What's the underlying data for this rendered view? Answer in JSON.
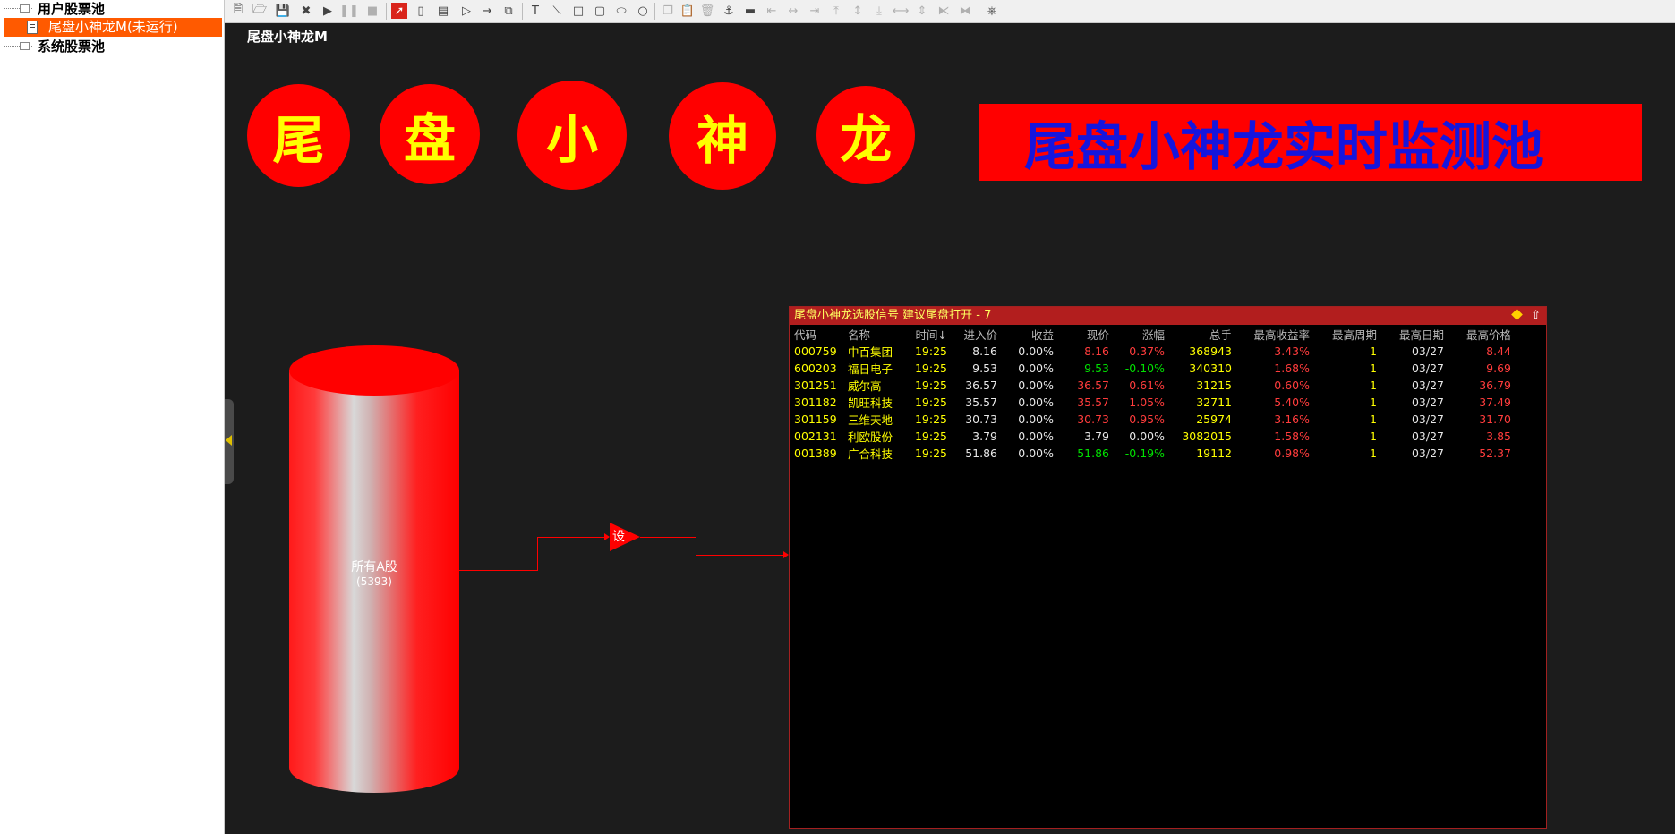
{
  "tree": {
    "user_pool": "用户股票池",
    "selected_item": "尾盘小神龙M(未运行)",
    "system_pool": "系统股票池"
  },
  "toolbar": {
    "icons": [
      "new-file-icon",
      "open-folder-icon",
      "save-icon",
      "close-icon",
      "run-icon",
      "pause-icon",
      "stop-icon",
      "pointer-icon",
      "rounded-rect-tool-icon",
      "table-tool-icon",
      "play-tool-icon",
      "arrow-tool-icon",
      "group-tool-icon",
      "text-tool-icon",
      "line-tool-icon",
      "rect-tool-icon",
      "round-rect-tool-icon",
      "ellipse-tool-icon",
      "circle-tool-icon",
      "copy-icon",
      "paste-icon",
      "delete-icon",
      "fill-icon",
      "line-style-icon",
      "align-left-icon",
      "align-center-icon",
      "align-right-icon",
      "align-top-icon",
      "align-middle-icon",
      "align-bottom-icon",
      "same-width-icon",
      "same-height-icon",
      "distribute-h-icon",
      "distribute-v-icon",
      "layout-icon"
    ]
  },
  "canvas": {
    "title": "尾盘小神龙M",
    "circles": [
      "尾",
      "盘",
      "小",
      "神",
      "龙"
    ],
    "banner": "尾盘小神龙实时监测池",
    "cylinder_label": "所有A股",
    "cylinder_count": "(5393)",
    "filter_label": "设"
  },
  "panel": {
    "title": "尾盘小神龙选股信号 建议尾盘打开 - 7",
    "columns": [
      "代码",
      "名称",
      "时间↓",
      "进入价",
      "收益",
      "现价",
      "涨幅",
      "总手",
      "最高收益率",
      "最高周期",
      "最高日期",
      "最高价格"
    ],
    "rows": [
      {
        "code": "000759",
        "name": "中百集团",
        "time": "19:25",
        "entry": "8.16",
        "gain": "0.00%",
        "price": "8.16",
        "change": "0.37%",
        "volume": "368943",
        "max_rate": "3.43%",
        "max_period": "1",
        "max_date": "03/27",
        "max_price": "8.44",
        "trend": "up"
      },
      {
        "code": "600203",
        "name": "福日电子",
        "time": "19:25",
        "entry": "9.53",
        "gain": "0.00%",
        "price": "9.53",
        "change": "-0.10%",
        "volume": "340310",
        "max_rate": "1.68%",
        "max_period": "1",
        "max_date": "03/27",
        "max_price": "9.69",
        "trend": "down"
      },
      {
        "code": "301251",
        "name": "威尔高",
        "time": "19:25",
        "entry": "36.57",
        "gain": "0.00%",
        "price": "36.57",
        "change": "0.61%",
        "volume": "31215",
        "max_rate": "0.60%",
        "max_period": "1",
        "max_date": "03/27",
        "max_price": "36.79",
        "trend": "up"
      },
      {
        "code": "301182",
        "name": "凯旺科技",
        "time": "19:25",
        "entry": "35.57",
        "gain": "0.00%",
        "price": "35.57",
        "change": "1.05%",
        "volume": "32711",
        "max_rate": "5.40%",
        "max_period": "1",
        "max_date": "03/27",
        "max_price": "37.49",
        "trend": "up"
      },
      {
        "code": "301159",
        "name": "三维天地",
        "time": "19:25",
        "entry": "30.73",
        "gain": "0.00%",
        "price": "30.73",
        "change": "0.95%",
        "volume": "25974",
        "max_rate": "3.16%",
        "max_period": "1",
        "max_date": "03/27",
        "max_price": "31.70",
        "trend": "up"
      },
      {
        "code": "002131",
        "name": "利欧股份",
        "time": "19:25",
        "entry": "3.79",
        "gain": "0.00%",
        "price": "3.79",
        "change": "0.00%",
        "volume": "3082015",
        "max_rate": "1.58%",
        "max_period": "1",
        "max_date": "03/27",
        "max_price": "3.85",
        "trend": "flat"
      },
      {
        "code": "001389",
        "name": "广合科技",
        "time": "19:25",
        "entry": "51.86",
        "gain": "0.00%",
        "price": "51.86",
        "change": "-0.19%",
        "volume": "19112",
        "max_rate": "0.98%",
        "max_period": "1",
        "max_date": "03/27",
        "max_price": "52.37",
        "trend": "down"
      }
    ]
  },
  "colors": {
    "up": "#ff3c3c",
    "down": "#00e000",
    "flat": "#e8e8e8",
    "accent": "#ff5a00",
    "brand_red": "#ff0000",
    "banner_text": "#1515dd",
    "circle_text": "#ffff00"
  }
}
